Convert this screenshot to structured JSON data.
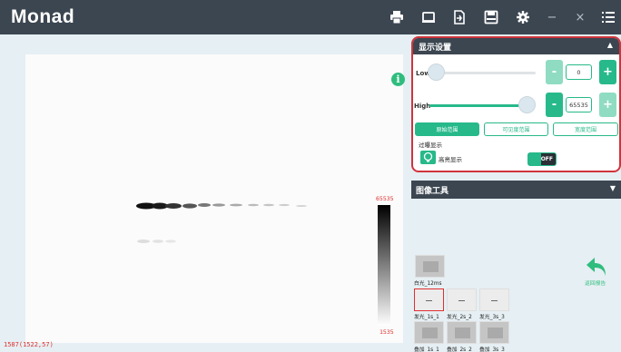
{
  "app": {
    "logo": "Monad"
  },
  "toolbar": {
    "icons": [
      "printer-icon",
      "window-icon",
      "export-icon",
      "save-icon",
      "gear-icon",
      "minimize-icon",
      "close-icon",
      "menu-list-icon"
    ],
    "minimize": "−",
    "close": "×"
  },
  "viewer": {
    "info": "i",
    "scale_max": "65535",
    "scale_min": "1535",
    "coordinate": "1587(1522,57)"
  },
  "display_settings": {
    "title": "显示设置",
    "low": {
      "label": "Low",
      "value": "0",
      "minus": "-",
      "plus": "+",
      "level": 0.0
    },
    "high": {
      "label": "High",
      "value": "65535",
      "minus": "-",
      "plus": "+",
      "level": 1.0
    },
    "range_buttons": [
      "原始范围",
      "可见度范围",
      "宽度范围"
    ],
    "overexposure_label": "过曝显示",
    "highlight_label": "高亮显示",
    "toggle": "OFF"
  },
  "image_tools": {
    "title": "图像工具"
  },
  "thumbnails": {
    "white_light": "白光_12ms",
    "luminescence": [
      "发光_1s_1",
      "发光_2s_2",
      "发光_3s_3"
    ],
    "overlay": [
      "叠加_1s_1",
      "叠加_2s_2",
      "叠加_3s_3"
    ]
  },
  "report": {
    "label": "返回报告"
  },
  "colors": {
    "accent": "#27b98a",
    "header": "#3c4651",
    "highlight_border": "#d0343c"
  }
}
